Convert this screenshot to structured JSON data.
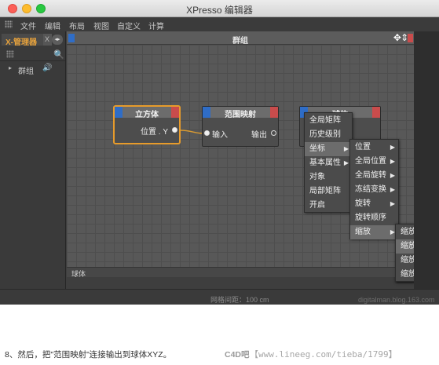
{
  "window": {
    "title": "XPresso 编辑器",
    "menu": [
      "文件",
      "编辑",
      "布局",
      "视图",
      "自定义",
      "计算"
    ]
  },
  "left_panel": {
    "active_tab": "X-管理器",
    "inactive_tab": "X",
    "nav": "◂▸",
    "search_icon": "🔍",
    "tree": [
      {
        "label": "群组",
        "arrow": "▸",
        "speaker": "🔊"
      }
    ]
  },
  "editor": {
    "title": "群组",
    "corner_icons": "✥⇕",
    "footer_label": "球体",
    "status_grid": "网格间距：100 cm"
  },
  "nodes": {
    "cube": {
      "title": "立方体",
      "output": "位置 . Y"
    },
    "range_mapper": {
      "title": "范围映射",
      "input": "输入",
      "output": "输出"
    },
    "sphere": {
      "title": "球体"
    }
  },
  "menus": {
    "level1": [
      {
        "label": "全局矩阵",
        "has_sub": false
      },
      {
        "label": "历史级别",
        "has_sub": false
      },
      {
        "label": "坐标",
        "has_sub": true,
        "highlighted": true
      },
      {
        "label": "基本属性",
        "has_sub": true
      },
      {
        "label": "对象",
        "has_sub": false
      },
      {
        "label": "局部矩阵",
        "has_sub": false
      },
      {
        "label": "开启",
        "has_sub": false
      }
    ],
    "level2": [
      {
        "label": "位置",
        "has_sub": true
      },
      {
        "label": "全局位置",
        "has_sub": true
      },
      {
        "label": "全局旋转",
        "has_sub": true
      },
      {
        "label": "冻结变换",
        "has_sub": true
      },
      {
        "label": "旋转",
        "has_sub": true
      },
      {
        "label": "旋转顺序",
        "has_sub": false
      },
      {
        "label": "缩放",
        "has_sub": true,
        "highlighted": true
      }
    ],
    "level3": [
      {
        "label": "缩放",
        "highlighted": false
      },
      {
        "label": "缩放 . X",
        "highlighted": true
      },
      {
        "label": "缩放 . Y",
        "highlighted": false
      },
      {
        "label": "缩放 . Z",
        "highlighted": false
      }
    ]
  },
  "watermark_blog": "digitalman.blog.163.com",
  "caption": "8、然后，把\"范围映射\"连接输出到球体XYZ。",
  "forum": {
    "logo": "C4D吧",
    "url": "【www.lineeg.com/tieba/1799】"
  },
  "colors": {
    "accent_orange": "#e79b2b",
    "node_blue": "#2f6dc7",
    "node_red": "#c94c4c",
    "wire": "#d89a32"
  }
}
